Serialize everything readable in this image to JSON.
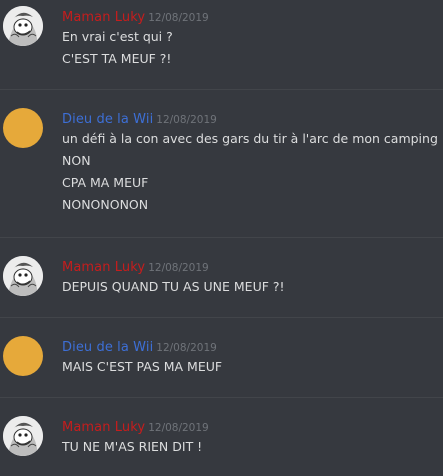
{
  "colors": {
    "background": "#36393f",
    "maman_luky": "#c51d1d",
    "dieu_wii": "#3d6fd6",
    "timestamp": "#6f7379",
    "text": "#dcddde",
    "orange_avatar": "#e6a93a"
  },
  "messages": [
    {
      "author": "Maman Luky",
      "timestamp": "12/08/2019",
      "avatar": "scrooge-avatar-icon",
      "lines": [
        "En vrai c'est qui ?",
        "C'EST TA MEUF ?!"
      ]
    },
    {
      "author": "Dieu de la Wii",
      "timestamp": "12/08/2019",
      "avatar": "orange-circle-avatar",
      "lines": [
        "un défi à la con avec des gars du tir à l'arc de mon camping",
        "NON",
        "CPA MA MEUF",
        "NONONONON"
      ]
    },
    {
      "author": "Maman Luky",
      "timestamp": "12/08/2019",
      "avatar": "scrooge-avatar-icon",
      "lines": [
        "DEPUIS QUAND TU AS UNE MEUF ?!"
      ]
    },
    {
      "author": "Dieu de la Wii",
      "timestamp": "12/08/2019",
      "avatar": "orange-circle-avatar",
      "lines": [
        "MAIS C'EST PAS MA MEUF"
      ]
    },
    {
      "author": "Maman Luky",
      "timestamp": "12/08/2019",
      "avatar": "scrooge-avatar-icon",
      "lines": [
        "TU NE M'AS RIEN DIT !"
      ]
    }
  ]
}
